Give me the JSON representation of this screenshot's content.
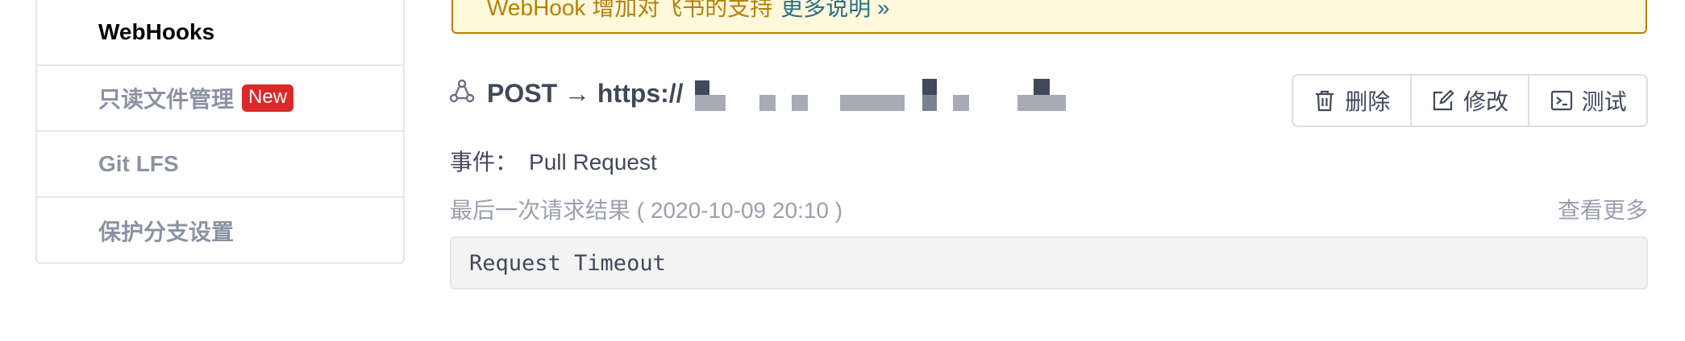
{
  "sidebar": {
    "items": [
      {
        "label": "WebHooks",
        "active": true
      },
      {
        "label": "只读文件管理",
        "badge": "New"
      },
      {
        "label": "Git LFS"
      },
      {
        "label": "保护分支设置"
      }
    ]
  },
  "notice": {
    "text": "WebHook 增加对飞书的支持",
    "link": "更多说明 »"
  },
  "hook": {
    "icon": "webhook-icon",
    "title": "POST → https://"
  },
  "actions": {
    "delete_label": "删除",
    "edit_label": "修改",
    "test_label": "测试"
  },
  "event": {
    "label": "事件：",
    "value": "Pull Request"
  },
  "last_request": {
    "label": "最后一次请求结果 ( 2020-10-09 20:10 )",
    "more": "查看更多"
  },
  "response": {
    "text": "Request Timeout"
  },
  "colors": {
    "badge": "#db2828",
    "notice_bg": "#fff8db",
    "notice_border": "#b58105",
    "link": "#276f86"
  }
}
